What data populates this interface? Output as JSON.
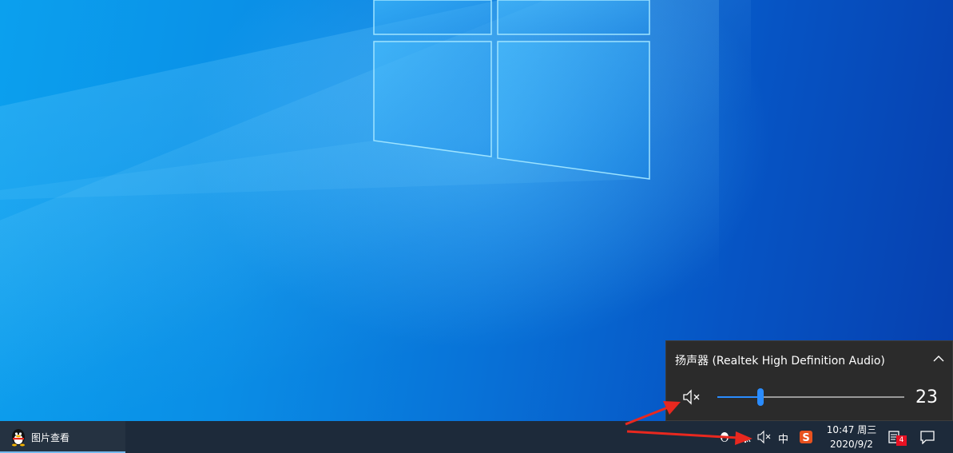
{
  "volume_flyout": {
    "device_name": "扬声器 (Realtek High Definition Audio)",
    "volume": 23,
    "volume_fraction": 0.23,
    "muted": true,
    "accent_color": "#2a8cff"
  },
  "taskbar": {
    "items": [
      {
        "label": "图片查看",
        "icon": "qq-penguin-icon",
        "active": true
      }
    ],
    "tray": {
      "ime_label": "中",
      "icons": [
        "chevron-up-icon",
        "network-icon",
        "speaker-muted-icon",
        "ime-icon",
        "sogou-icon"
      ]
    },
    "clock": {
      "time": "10:47 周三",
      "date": "2020/9/2"
    },
    "notifications_badge": "4"
  },
  "colors": {
    "taskbar_bg": "#1d2a3a",
    "flyout_bg": "#2b2b2b",
    "annotation_arrow": "#e8281f"
  }
}
